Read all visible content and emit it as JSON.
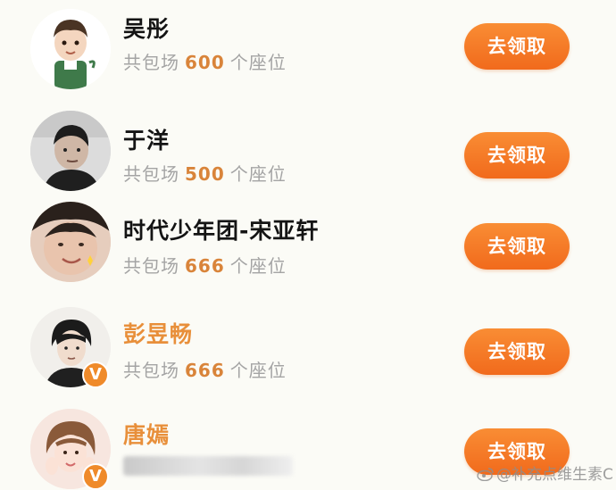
{
  "rows": [
    {
      "name": "吴彤",
      "seats_prefix": "共包场",
      "seats_count": "600",
      "seats_suffix": "个座位",
      "button": "去领取",
      "verified": false,
      "name_color": "#141414"
    },
    {
      "name": "于洋",
      "seats_prefix": "共包场",
      "seats_count": "500",
      "seats_suffix": "个座位",
      "button": "去领取",
      "verified": false,
      "name_color": "#141414"
    },
    {
      "name": "时代少年团-宋亚轩",
      "seats_prefix": "共包场",
      "seats_count": "666",
      "seats_suffix": "个座位",
      "button": "去领取",
      "verified": false,
      "name_color": "#141414"
    },
    {
      "name": "彭昱畅",
      "seats_prefix": "共包场",
      "seats_count": "666",
      "seats_suffix": "个座位",
      "button": "去领取",
      "verified": true,
      "name_color": "#e88f3a"
    },
    {
      "name": "唐嫣",
      "seats_prefix": "",
      "seats_count": "",
      "seats_suffix": "",
      "button": "去领取",
      "verified": true,
      "name_color": "#e88f3a"
    }
  ],
  "verified_badge": "V",
  "watermark": {
    "text": "@补充点维生素C",
    "icon": "weibo-logo-icon"
  },
  "colors": {
    "button_top": "#f98d34",
    "button_bottom": "#f16a1c",
    "count": "#d9843a",
    "badge": "#ef8a2a"
  }
}
